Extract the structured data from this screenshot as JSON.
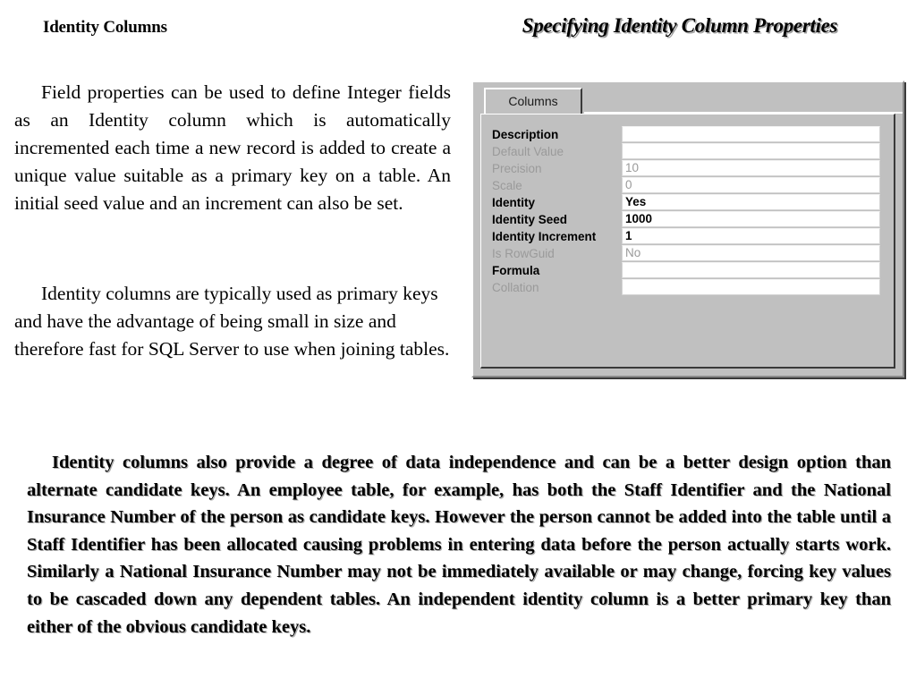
{
  "slide": {
    "heading_left": "Identity Columns",
    "heading_right": "Specifying Identity Column Properties",
    "paragraph_1": "Field properties can be used to define Integer fields as an Identity column which is automatically incremented each time a new record is added to create a unique value suitable as a primary key on a table. An initial seed value and an increment can also be set.",
    "paragraph_2": "Identity columns are typically used as primary keys and have the advantage of being small in size and therefore fast for SQL Server to use when joining tables.",
    "paragraph_3": "Identity columns also provide a degree of data independence and can be a better design option than alternate candidate keys. An employee table, for example, has both the Staff Identifier and the National Insurance Number of the person as candidate keys. However the person cannot be added into the table until a Staff Identifier has been allocated causing problems in entering data before the person actually starts work. Similarly a National Insurance Number may not be immediately available or may change, forcing key values to be cascaded down any dependent tables. An independent identity column is a better primary key than either of the obvious candidate keys."
  },
  "dialog": {
    "tab_label": "Columns",
    "colors": {
      "face": "#c0c0c0",
      "field_background": "#ffffff",
      "disabled_text": "#9a9a9a",
      "enabled_text": "#000000"
    },
    "properties": [
      {
        "label": "Description",
        "value": "",
        "enabled": true
      },
      {
        "label": "Default Value",
        "value": "",
        "enabled": false
      },
      {
        "label": "Precision",
        "value": "10",
        "enabled": false
      },
      {
        "label": "Scale",
        "value": "0",
        "enabled": false
      },
      {
        "label": "Identity",
        "value": "Yes",
        "enabled": true
      },
      {
        "label": "Identity Seed",
        "value": "1000",
        "enabled": true
      },
      {
        "label": "Identity Increment",
        "value": "1",
        "enabled": true
      },
      {
        "label": "Is RowGuid",
        "value": "No",
        "enabled": false
      },
      {
        "label": "Formula",
        "value": "",
        "enabled": true
      },
      {
        "label": "Collation",
        "value": "",
        "enabled": false
      }
    ]
  }
}
